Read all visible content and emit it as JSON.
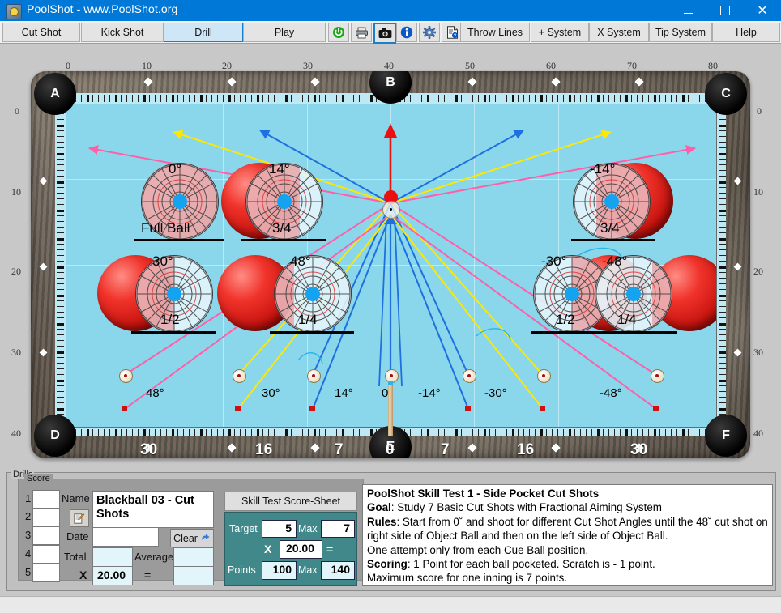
{
  "window": {
    "title": "PoolShot - www.PoolShot.org",
    "app_icon": "poolshot-logo-icon",
    "minimize": "—",
    "maximize": "□",
    "close": "✕"
  },
  "toolbar": {
    "mode_buttons": [
      {
        "label": "Cut Shot",
        "selected": false
      },
      {
        "label": "Kick Shot",
        "selected": false
      },
      {
        "label": "Drill",
        "selected": true
      },
      {
        "label": "Play",
        "selected": false
      }
    ],
    "icon_buttons": [
      {
        "name": "power-icon",
        "glyph": "⏻",
        "color": "#18a018",
        "selected": false
      },
      {
        "name": "printer-icon",
        "glyph": "⎙",
        "color": "#444444",
        "selected": false
      },
      {
        "name": "camera-icon",
        "glyph": "▣",
        "color": "#101010",
        "selected": true
      },
      {
        "name": "info-icon",
        "glyph": "i",
        "color": "#0b57c8",
        "selected": false
      },
      {
        "name": "gear-icon",
        "glyph": "⚙",
        "color": "#3b6fb5",
        "selected": false
      },
      {
        "name": "help-document-icon",
        "glyph": "⍰",
        "color": "#2b2b2b",
        "selected": false
      }
    ],
    "system_buttons": [
      {
        "label": "Throw Lines"
      },
      {
        "label": "+ System"
      },
      {
        "label": "X System"
      },
      {
        "label": "Tip System"
      },
      {
        "label": "Help"
      }
    ]
  },
  "table": {
    "top_ruler": [
      "0",
      "10",
      "20",
      "30",
      "40",
      "50",
      "60",
      "70",
      "80"
    ],
    "left_ruler": [
      "0",
      "10",
      "20",
      "30",
      "40"
    ],
    "right_ruler": [
      "0",
      "10",
      "20",
      "30",
      "40"
    ],
    "pockets": [
      {
        "label": "A",
        "position": "top-left"
      },
      {
        "label": "B",
        "position": "top-middle"
      },
      {
        "label": "C",
        "position": "top-right"
      },
      {
        "label": "D",
        "position": "bottom-left"
      },
      {
        "label": "E",
        "position": "bottom-middle"
      },
      {
        "label": "F",
        "position": "bottom-right"
      }
    ],
    "top_row_balls": [
      {
        "angle": "0°",
        "fraction": "Full Ball"
      },
      {
        "angle": "14°",
        "fraction": "3/4"
      },
      {
        "angle": "-14°",
        "fraction": "3/4"
      }
    ],
    "bottom_row_balls": [
      {
        "angle": "30°",
        "fraction": "1/2"
      },
      {
        "angle": "48°",
        "fraction": "1/4"
      },
      {
        "angle": "-30°",
        "fraction": "1/2"
      },
      {
        "angle": "-48°",
        "fraction": "1/4"
      }
    ],
    "angle_labels": [
      "48°",
      "30°",
      "14°",
      "0°",
      "-14°",
      "-30°",
      "-48°"
    ],
    "bottom_numbers": [
      "30",
      "16",
      "7",
      "0",
      "7",
      "16",
      "30"
    ]
  },
  "drills": {
    "group_label": "Drills",
    "score_group_label": "Score",
    "rows": [
      "1",
      "2",
      "3",
      "4",
      "5"
    ],
    "name_label": "Name",
    "name_value": "Blackball 03 - Cut Shots",
    "edit_icon": "edit-note-icon",
    "date_label": "Date",
    "date_value": "",
    "clear_label": "Clear",
    "clear_icon": "undo-arrow-icon",
    "total_label": "Total",
    "total_value": "",
    "average_label": "Average",
    "average_value": "",
    "multiply_symbol": "X",
    "multiplier_value": "20.00",
    "equals_symbol": "=",
    "result_value": ""
  },
  "score_sheet": {
    "button_label": "Skill Test Score-Sheet",
    "target_label": "Target",
    "target_value": "5",
    "target_max_label": "Max",
    "target_max_value": "7",
    "multiply_symbol": "X",
    "multiplier_value": "20.00",
    "equals_symbol": "=",
    "points_label": "Points",
    "points_value": "100",
    "points_max_label": "Max",
    "points_max_value": "140"
  },
  "description": {
    "title": "PoolShot Skill Test 1 - Side Pocket Cut Shots",
    "goal_label": "Goal",
    "goal_text": ": Study 7 Basic Cut Shots with Fractional Aiming System",
    "rules_label": "Rules",
    "rules_text": ": Start from 0˚ and shoot for different Cut Shot Angles until the 48˚ cut shot on right side of Object Ball and then on the left side of Object Ball.",
    "rules_text2": "One attempt only from each Cue Ball position.",
    "scoring_label": "Scoring",
    "scoring_text": ": 1 Point for each ball pocketed. Scratch is - 1 point.",
    "scoring_text2": "Maximum score for one inning is 7 points."
  },
  "colors": {
    "titlebar": "#0078d7",
    "selected_button": "#cfe6f7",
    "cloth": "#8ad7ec",
    "teal_panel": "#41888a",
    "ball_red": "#e02020",
    "line_pink": "#ff5fa8",
    "line_yellow": "#ffe800",
    "line_blue": "#1e6fe0",
    "line_red": "#e81010",
    "line_cyan": "#29b6e8"
  }
}
